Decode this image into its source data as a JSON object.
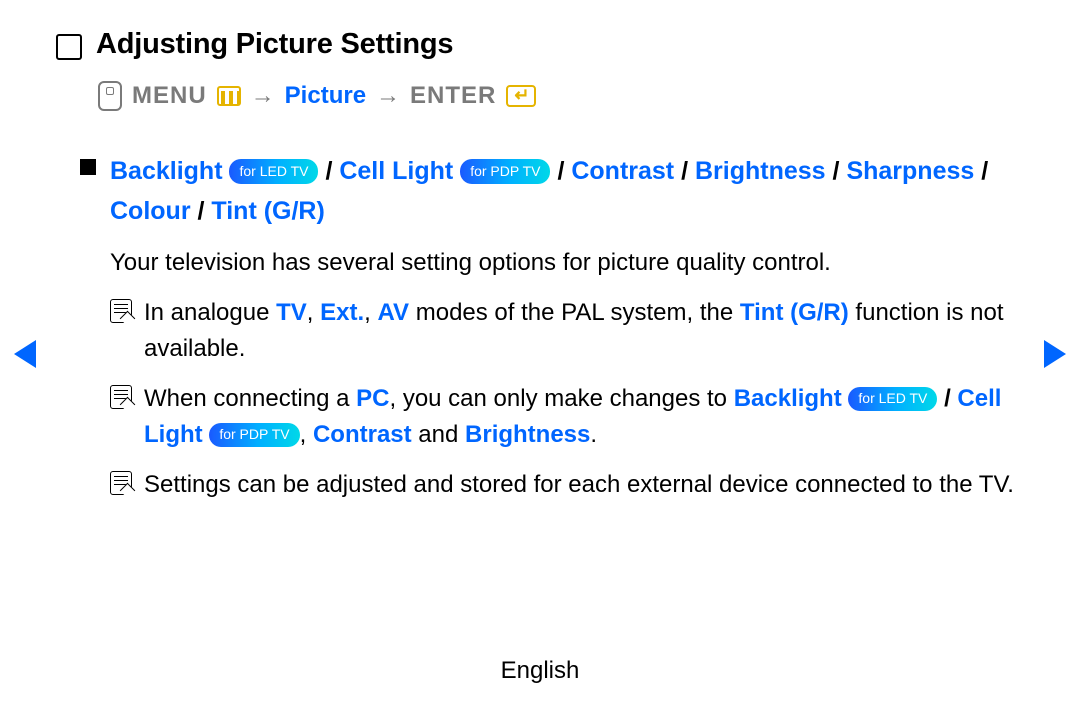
{
  "header": {
    "title": "Adjusting Picture Settings"
  },
  "breadcrumb": {
    "menu": "MENU",
    "arrow": "→",
    "picture": "Picture",
    "enter": "ENTER"
  },
  "options": {
    "backlight": "Backlight",
    "led_pill": "for LED TV",
    "cell_light": "Cell Light",
    "pdp_pill": "for PDP TV",
    "contrast": "Contrast",
    "brightness": "Brightness",
    "sharpness": "Sharpness",
    "colour": "Colour",
    "tint": "Tint (G/R)",
    "slash": " / "
  },
  "description": "Your television has several setting options for picture quality control.",
  "notes": {
    "n1": {
      "pre": "In analogue ",
      "tv": "TV",
      "comma1": ", ",
      "ext": "Ext.",
      "comma2": ", ",
      "av": "AV",
      "mid": " modes of the PAL system, the ",
      "tint": "Tint (G/R)",
      "post": " function is not available."
    },
    "n2": {
      "pre": "When connecting a ",
      "pc": "PC",
      "mid1": ", you can only make changes to ",
      "backlight": "Backlight",
      "slash": " / ",
      "cell_light": "Cell Light",
      "comma": ", ",
      "contrast": "Contrast",
      "and": " and ",
      "brightness": "Brightness",
      "dot": "."
    },
    "n3": "Settings can be adjusted and stored for each external device connected to the TV."
  },
  "footer": "English"
}
